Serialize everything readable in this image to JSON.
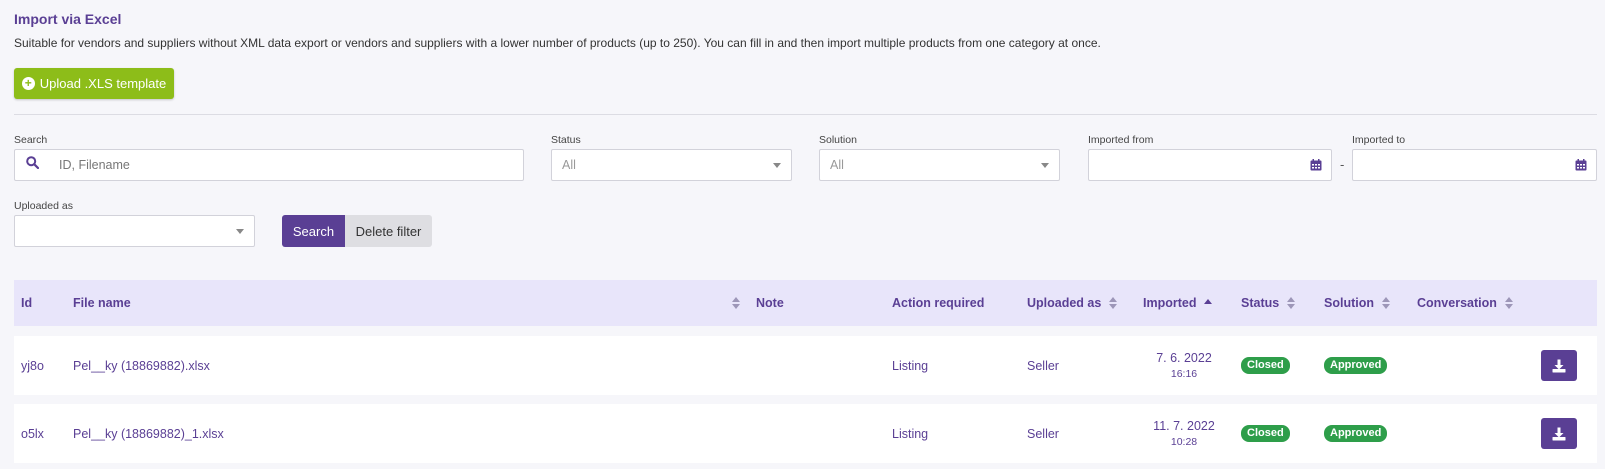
{
  "section": {
    "title": "Import via Excel",
    "description": "Suitable for vendors and suppliers without XML data export or vendors and suppliers with a lower number of products (up to 250). You can fill in and then import multiple products from one category at once."
  },
  "upload_button": {
    "label": "Upload .XLS template",
    "icon": "plus-circle-icon",
    "color": "#8dbd19"
  },
  "filters": {
    "search": {
      "label": "Search",
      "placeholder": "ID, Filename",
      "value": ""
    },
    "status": {
      "label": "Status",
      "value": "All"
    },
    "solution": {
      "label": "Solution",
      "value": "All"
    },
    "imported_from": {
      "label": "Imported from",
      "value": ""
    },
    "imported_to": {
      "label": "Imported to",
      "value": ""
    },
    "range_separator": "-",
    "uploaded_as": {
      "label": "Uploaded as",
      "value": ""
    },
    "search_button": "Search",
    "delete_filter_button": "Delete filter"
  },
  "table": {
    "columns": {
      "id": "Id",
      "file_name": "File name",
      "note": "Note",
      "action_required": "Action required",
      "uploaded_as": "Uploaded as",
      "imported": "Imported",
      "status": "Status",
      "solution": "Solution",
      "conversation": "Conversation"
    },
    "sorted_column": "imported",
    "sort_direction": "ascending",
    "rows": [
      {
        "id": "yj8o",
        "file_name": "Pel__ky (18869882).xlsx",
        "note": "",
        "action_required": "Listing",
        "uploaded_as": "Seller",
        "imported_date": "7. 6. 2022",
        "imported_time": "16:16",
        "status": "Closed",
        "solution": "Approved",
        "conversation": ""
      },
      {
        "id": "o5lx",
        "file_name": "Pel__ky (18869882)_1.xlsx",
        "note": "",
        "action_required": "Listing",
        "uploaded_as": "Seller",
        "imported_date": "11. 7. 2022",
        "imported_time": "10:28",
        "status": "Closed",
        "solution": "Approved",
        "conversation": ""
      }
    ]
  },
  "colors": {
    "accent": "#5a3f94",
    "header_bg": "#e8e5fa",
    "badge_green": "#2e9e4a"
  }
}
